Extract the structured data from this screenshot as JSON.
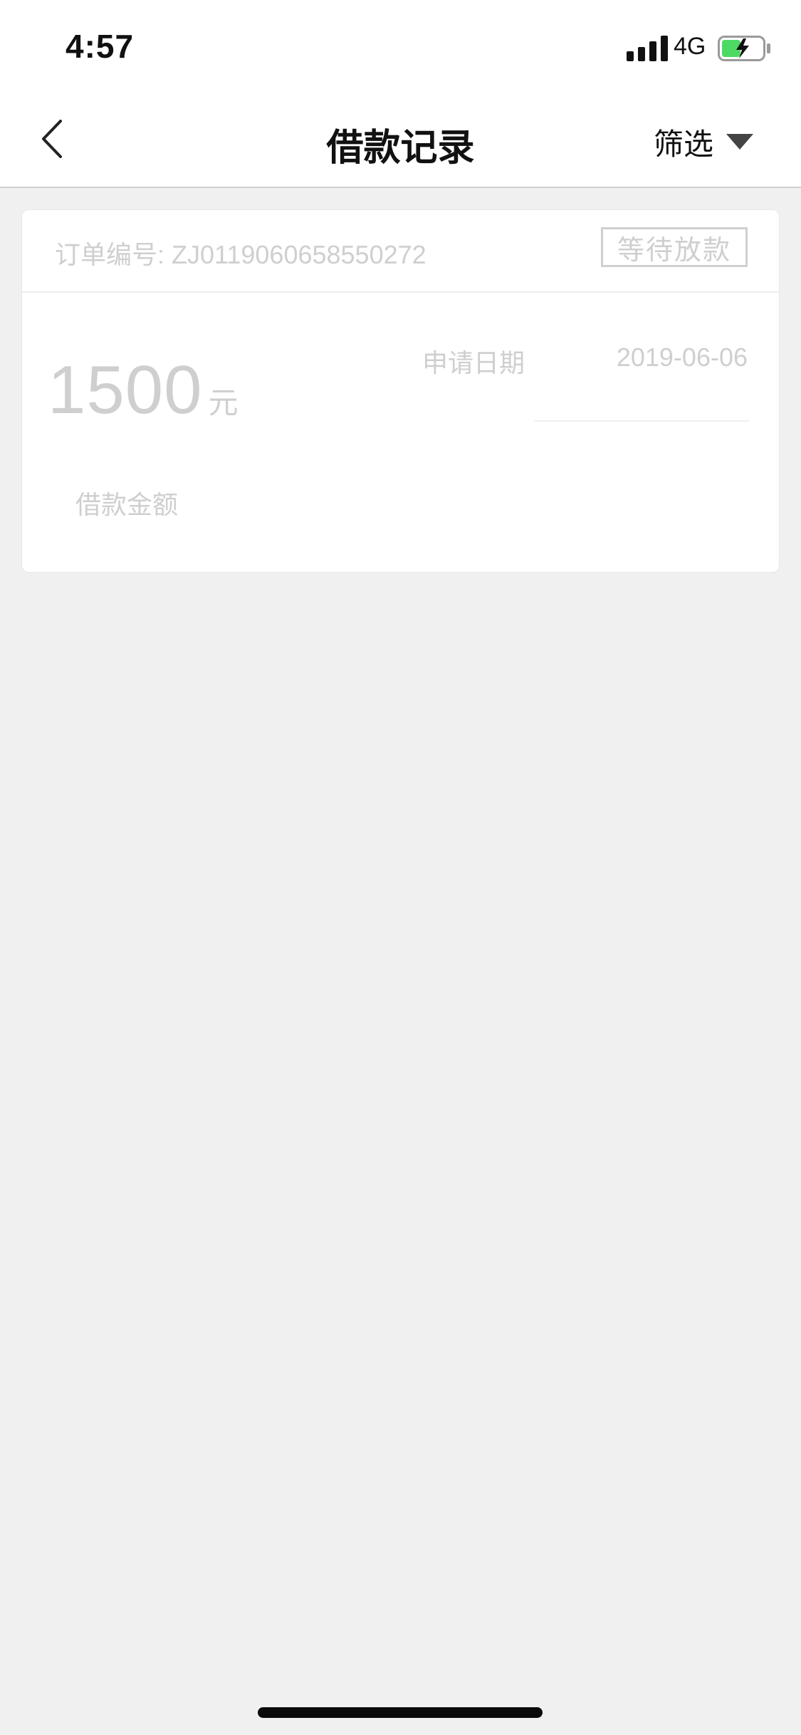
{
  "status_bar": {
    "time": "4:57",
    "network": "4G",
    "signal_icon": "signal-bars-icon",
    "battery_icon": "battery-charging-icon",
    "battery_color": "#4cd964"
  },
  "nav": {
    "back_icon": "chevron-left-icon",
    "title": "借款记录",
    "filter_label": "筛选",
    "filter_icon": "caret-down-icon"
  },
  "record": {
    "order_no": "订单编号: ZJ0119060658550272",
    "status": "等待放款",
    "amount": "1500",
    "amount_unit": "元",
    "amount_label": "借款金额",
    "date_label": "申请日期",
    "date_value": "2019-06-06"
  },
  "colors": {
    "page_background": "#f0f0f0",
    "muted_text": "#cfcfcf",
    "primary_text": "#111111"
  }
}
